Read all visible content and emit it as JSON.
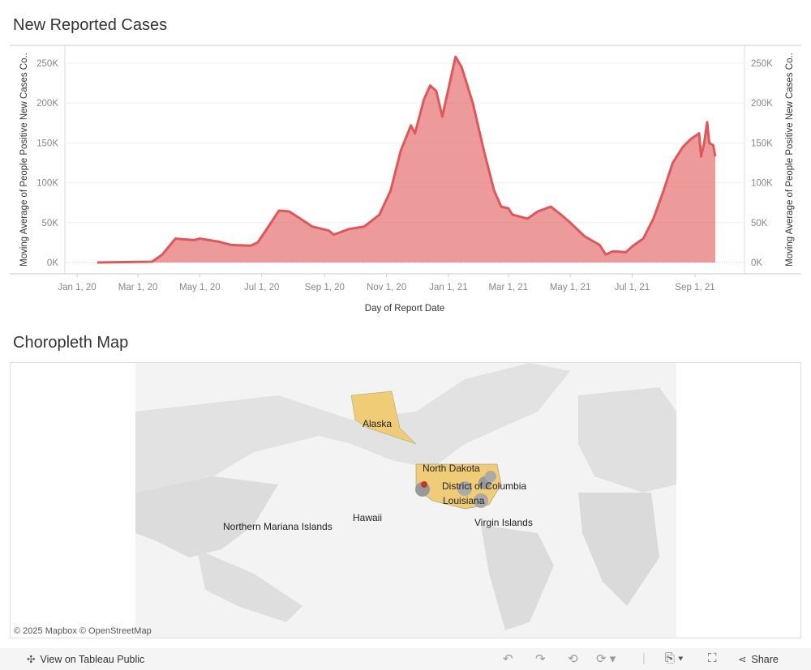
{
  "chart_title": "New Reported Cases",
  "map_title": "Choropleth Map",
  "chart_data": {
    "type": "area",
    "title": "New Reported Cases",
    "xlabel": "Day of Report Date",
    "ylabel": "Moving Average of People Positive New Cases Co..",
    "ylabel_right": "Moving Average of People Positive New Cases Co..",
    "ylim": [
      0,
      250000
    ],
    "y_ticks": [
      "0K",
      "50K",
      "100K",
      "150K",
      "200K",
      "250K"
    ],
    "x_ticks": [
      "Jan 1, 20",
      "Mar 1, 20",
      "May 1, 20",
      "Jul 1, 20",
      "Sep 1, 20",
      "Nov 1, 20",
      "Jan 1, 21",
      "Mar 1, 21",
      "May 1, 21",
      "Jul 1, 21",
      "Sep 1, 21"
    ],
    "x_tick_dates": [
      "2020-01-01",
      "2020-03-01",
      "2020-05-01",
      "2020-07-01",
      "2020-09-01",
      "2020-11-01",
      "2021-01-01",
      "2021-03-01",
      "2021-05-01",
      "2021-07-01",
      "2021-09-01"
    ],
    "color": "#e15759",
    "grid": true,
    "points": [
      [
        "2020-01-21",
        0
      ],
      [
        "2020-03-15",
        1000
      ],
      [
        "2020-03-25",
        10000
      ],
      [
        "2020-04-07",
        30000
      ],
      [
        "2020-04-25",
        28000
      ],
      [
        "2020-05-01",
        30000
      ],
      [
        "2020-05-20",
        26000
      ],
      [
        "2020-06-01",
        22000
      ],
      [
        "2020-06-20",
        21000
      ],
      [
        "2020-06-27",
        25000
      ],
      [
        "2020-07-05",
        40000
      ],
      [
        "2020-07-18",
        65000
      ],
      [
        "2020-07-28",
        64000
      ],
      [
        "2020-08-08",
        55000
      ],
      [
        "2020-08-20",
        45000
      ],
      [
        "2020-09-05",
        40000
      ],
      [
        "2020-09-10",
        35000
      ],
      [
        "2020-09-25",
        42000
      ],
      [
        "2020-10-10",
        45000
      ],
      [
        "2020-10-25",
        60000
      ],
      [
        "2020-11-05",
        90000
      ],
      [
        "2020-11-15",
        140000
      ],
      [
        "2020-11-25",
        172000
      ],
      [
        "2020-11-29",
        162000
      ],
      [
        "2020-12-08",
        205000
      ],
      [
        "2020-12-14",
        222000
      ],
      [
        "2020-12-20",
        215000
      ],
      [
        "2020-12-26",
        183000
      ],
      [
        "2021-01-08",
        258000
      ],
      [
        "2021-01-14",
        245000
      ],
      [
        "2021-01-25",
        200000
      ],
      [
        "2021-02-05",
        140000
      ],
      [
        "2021-02-15",
        90000
      ],
      [
        "2021-02-22",
        70000
      ],
      [
        "2021-03-01",
        68000
      ],
      [
        "2021-03-05",
        60000
      ],
      [
        "2021-03-20",
        55000
      ],
      [
        "2021-03-30",
        64000
      ],
      [
        "2021-04-12",
        70000
      ],
      [
        "2021-04-22",
        60000
      ],
      [
        "2021-05-01",
        50000
      ],
      [
        "2021-05-15",
        33000
      ],
      [
        "2021-05-30",
        22000
      ],
      [
        "2021-06-05",
        10000
      ],
      [
        "2021-06-12",
        14000
      ],
      [
        "2021-06-25",
        13000
      ],
      [
        "2021-07-01",
        20000
      ],
      [
        "2021-07-12",
        30000
      ],
      [
        "2021-07-22",
        55000
      ],
      [
        "2021-08-01",
        90000
      ],
      [
        "2021-08-10",
        125000
      ],
      [
        "2021-08-20",
        145000
      ],
      [
        "2021-08-28",
        155000
      ],
      [
        "2021-09-05",
        162000
      ],
      [
        "2021-09-07",
        133000
      ],
      [
        "2021-09-10",
        150000
      ],
      [
        "2021-09-13",
        176000
      ],
      [
        "2021-09-15",
        150000
      ],
      [
        "2021-09-19",
        147000
      ],
      [
        "2021-09-21",
        133000
      ]
    ]
  },
  "map": {
    "labels": [
      "Alaska",
      "North Dakota",
      "District of Columbia",
      "Louisiana",
      "Hawaii",
      "Northern Mariana Islands",
      "Virgin Islands"
    ],
    "credit": "© 2025 Mapbox  © OpenStreetMap",
    "fill_color": "#f1cc77"
  },
  "footer": {
    "view_label": "View on Tableau Public",
    "share_label": "Share"
  }
}
